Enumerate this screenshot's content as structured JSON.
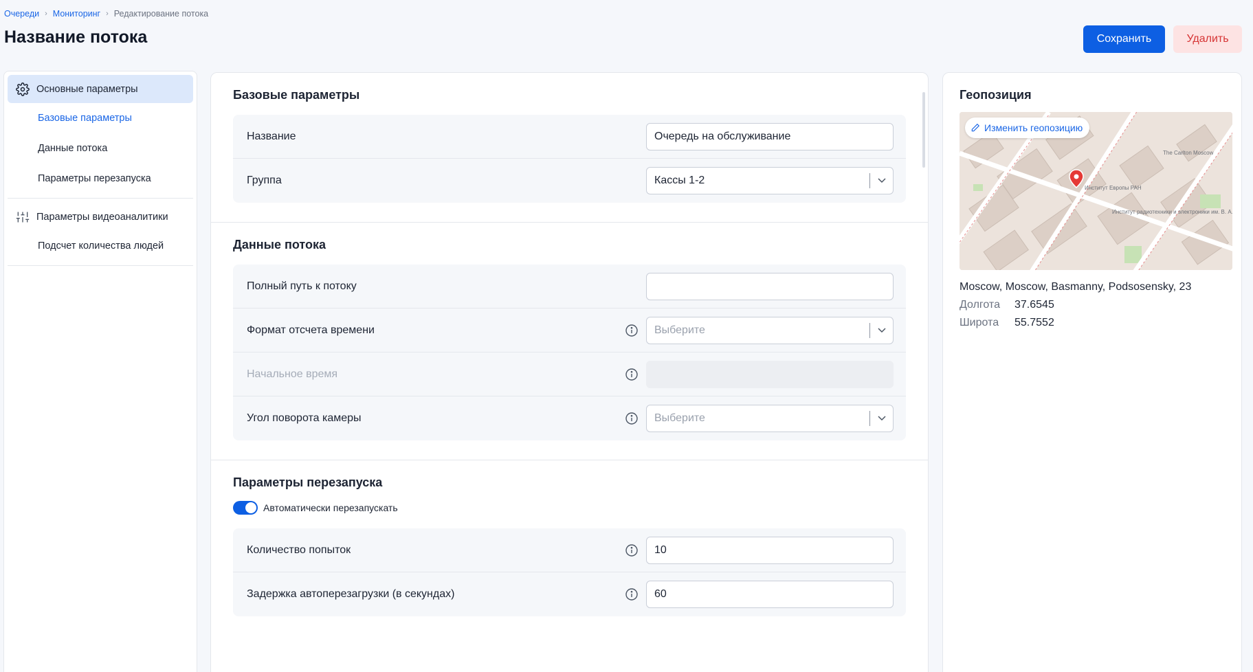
{
  "breadcrumb": {
    "items": [
      "Очереди",
      "Мониторинг"
    ],
    "current": "Редактирование потока"
  },
  "page": {
    "title": "Название потока"
  },
  "actions": {
    "save_label": "Сохранить",
    "delete_label": "Удалить"
  },
  "sidebar": {
    "groups": [
      {
        "label": "Основные параметры",
        "icon": "gear-icon",
        "items": [
          "Базовые параметры",
          "Данные потока",
          "Параметры перезапуска"
        ]
      },
      {
        "label": "Параметры видеоаналитики",
        "icon": "sliders-icon",
        "items": [
          "Подсчет количества людей"
        ]
      }
    ]
  },
  "base": {
    "title": "Базовые параметры",
    "name_label": "Название",
    "name_value": "Очередь на обслуживание",
    "group_label": "Группа",
    "group_value": "Кассы 1-2"
  },
  "stream": {
    "title": "Данные потока",
    "path_label": "Полный путь к потоку",
    "path_value": "",
    "time_format_label": "Формат отсчета времени",
    "time_format_placeholder": "Выберите",
    "start_time_label": "Начальное время",
    "rotation_label": "Угол поворота камеры",
    "rotation_placeholder": "Выберите"
  },
  "restart": {
    "title": "Параметры перезапуска",
    "auto_label": "Автоматически перезапускать",
    "auto_enabled": true,
    "attempts_label": "Количество попыток",
    "attempts_value": "10",
    "delay_label": "Задержка автоперезагрузки (в секундах)",
    "delay_value": "60"
  },
  "geo": {
    "title": "Геопозиция",
    "change_label": "Изменить геопозицию",
    "address": "Moscow, Moscow, Basmanny, Podsosensky, 23",
    "lon_label": "Долгота",
    "lon_value": "37.6545",
    "lat_label": "Широта",
    "lat_value": "55.7552",
    "map_labels": {
      "institute_europe": "Институт Европы РАН",
      "institute_radio": "Институт радиотехники и электроники им. В. А. Котельникова РАН",
      "hotel": "The Carlton Moscow"
    }
  },
  "colors": {
    "accent": "#0d5fe3",
    "danger_bg": "#fde3e3",
    "danger_text": "#d63434",
    "active_nav_bg": "#dce8fb"
  }
}
